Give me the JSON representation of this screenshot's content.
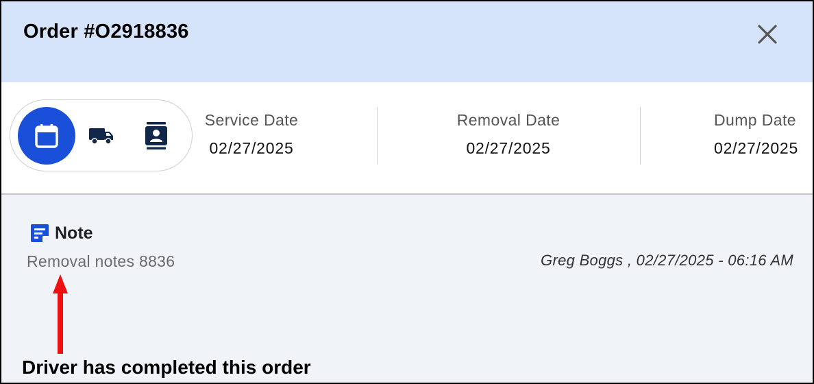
{
  "header": {
    "title": "Order #O2918836"
  },
  "toolbar": {
    "buttons": [
      {
        "icon": "calendar-icon",
        "active": true
      },
      {
        "icon": "truck-icon",
        "active": false
      },
      {
        "icon": "contact-card-icon",
        "active": false
      }
    ]
  },
  "dates": [
    {
      "label": "Service Date",
      "value": "02/27/2025"
    },
    {
      "label": "Removal Date",
      "value": "02/27/2025"
    },
    {
      "label": "Dump Date",
      "value": "02/27/2025"
    }
  ],
  "note": {
    "title": "Note",
    "text": "Removal notes 8836",
    "meta": "Greg Boggs , 02/27/2025 - 06:16 AM"
  },
  "annotation": {
    "text": "Driver has completed this order"
  },
  "colors": {
    "header_bg": "#d6e4fb",
    "accent": "#1a4fd9",
    "icon_dark": "#12284a",
    "annotation_arrow": "#ee1111"
  }
}
